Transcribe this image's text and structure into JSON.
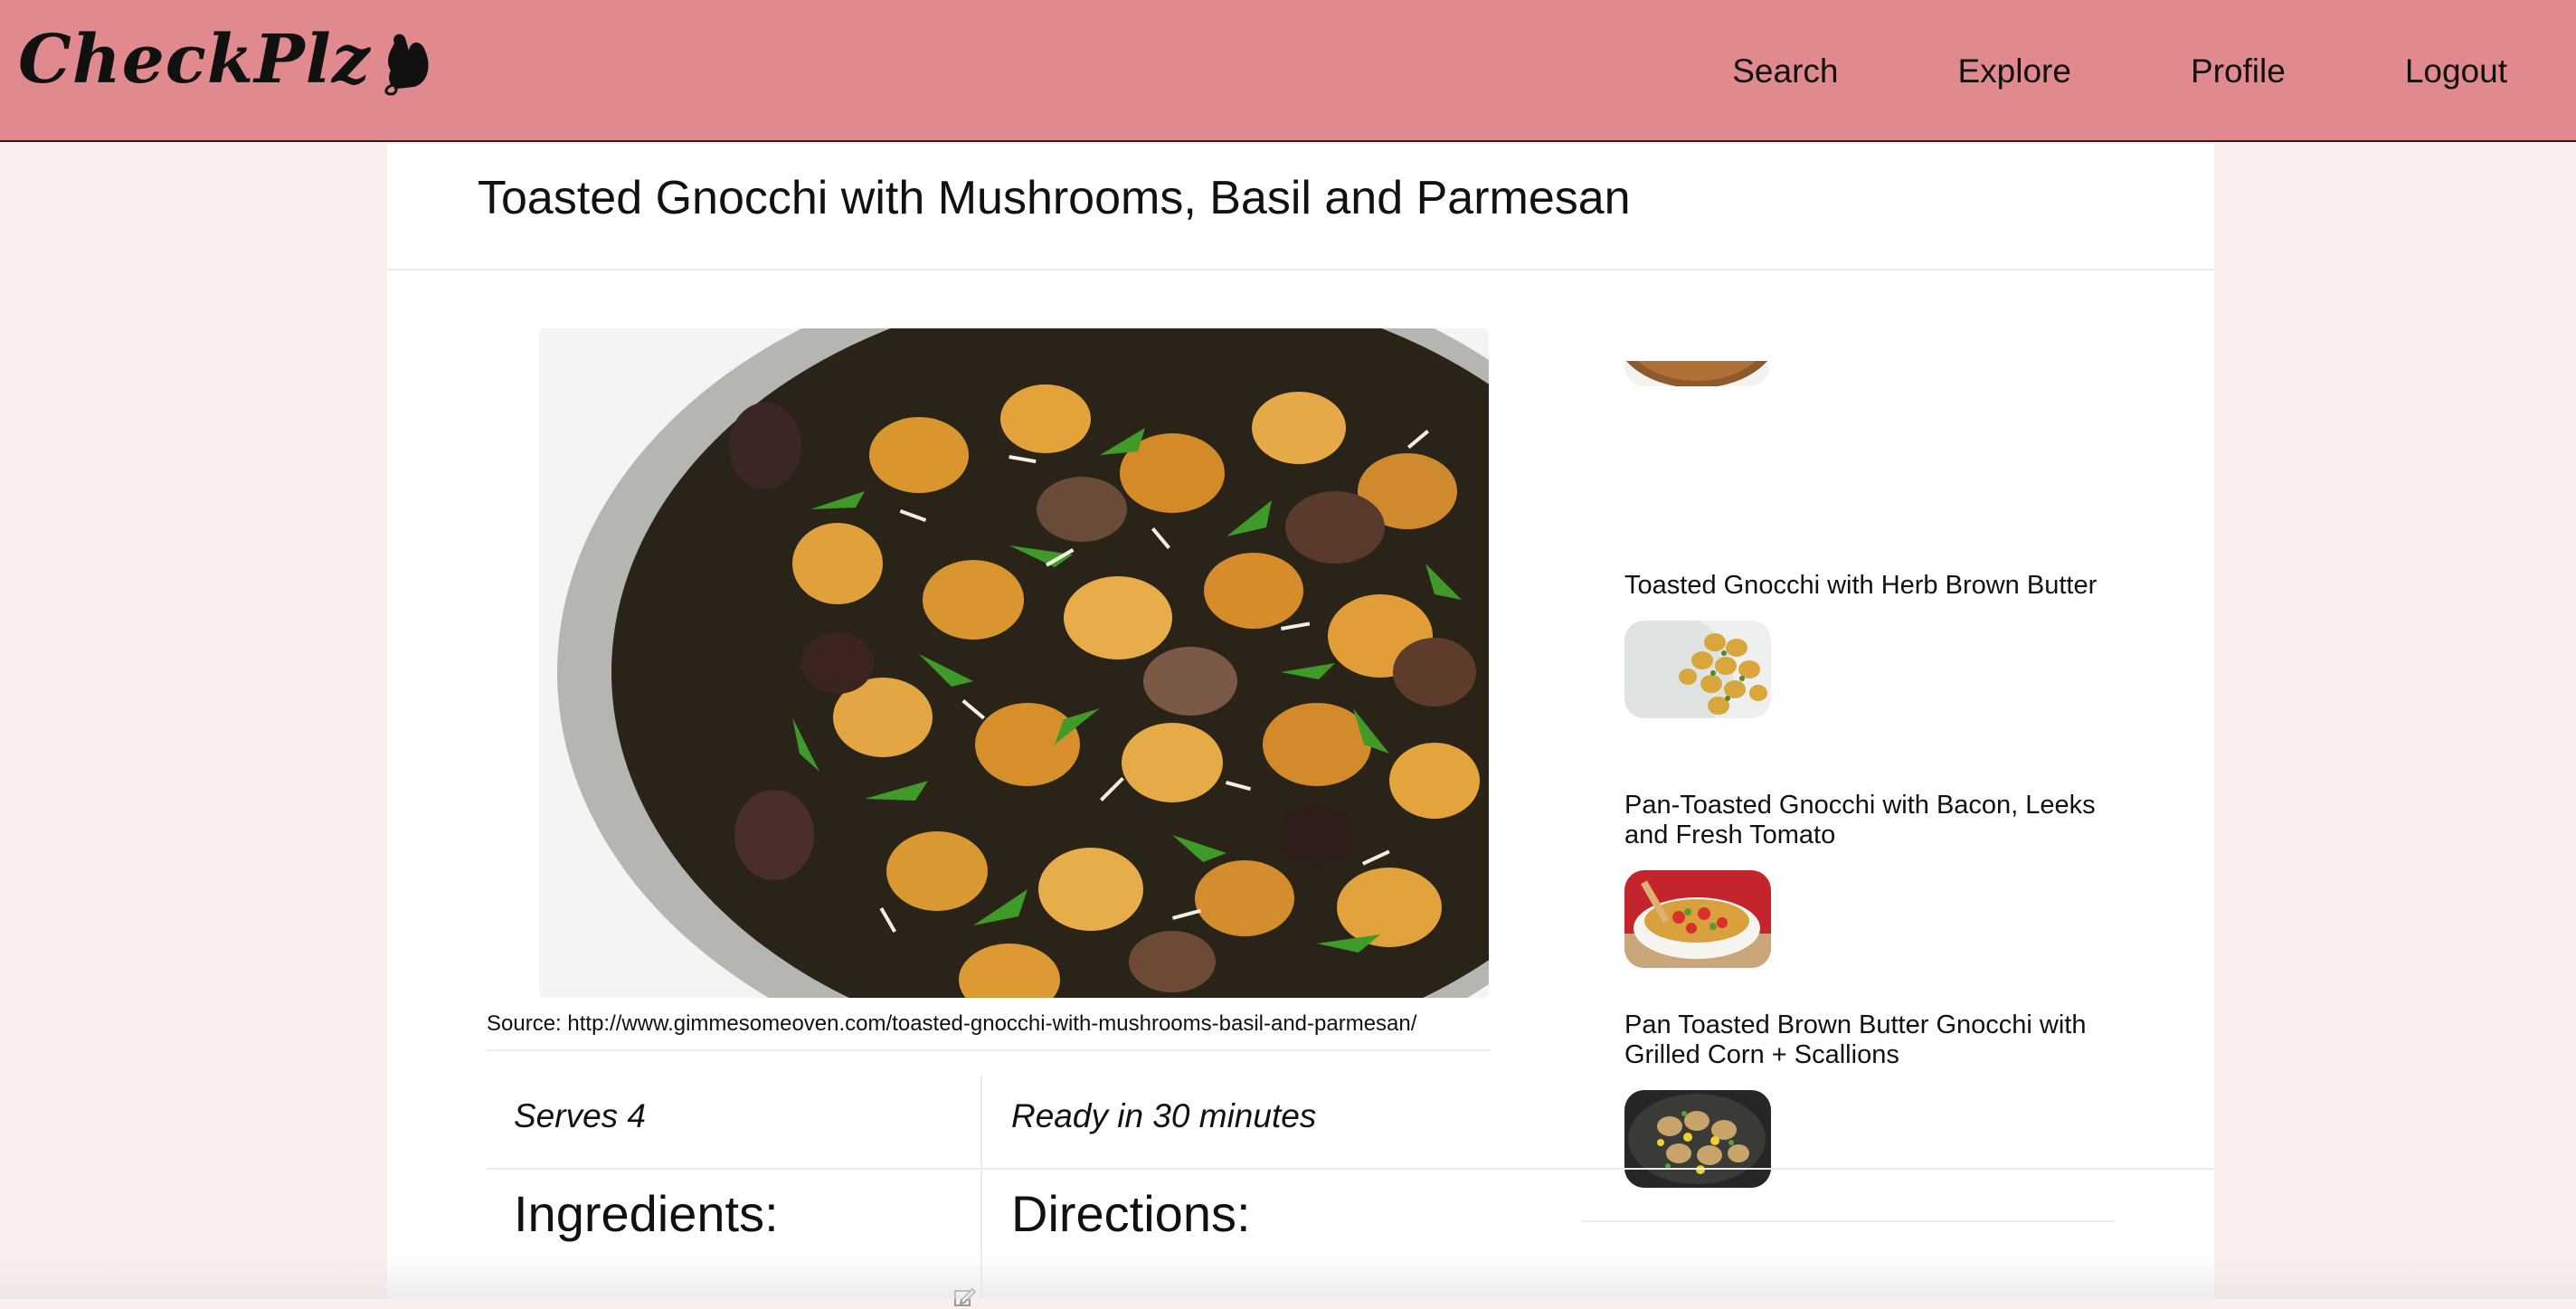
{
  "navbar": {
    "brand": "CheckPlz",
    "brand_icon": "oven-mitt-icon",
    "links": [
      "Search",
      "Explore",
      "Profile",
      "Logout"
    ],
    "background": "#e08a8f"
  },
  "recipe": {
    "title": "Toasted Gnocchi with Mushrooms, Basil and Parmesan",
    "source": "Source: http://www.gimmesomeoven.com/toasted-gnocchi-with-mushrooms-basil-and-parmesan/",
    "serves": "Serves 4",
    "ready": "Ready in 30 minutes",
    "ingredients_heading": "Ingredients:",
    "directions_heading": "Directions:"
  },
  "similar": [
    {
      "title": "Toasted Gnocchi with Herb Brown Butter"
    },
    {
      "title": "Pan-Toasted Gnocchi with Bacon, Leeks and Fresh Tomato"
    },
    {
      "title": "Pan Toasted Brown Butter Gnocchi with Grilled Corn + Scallions"
    }
  ]
}
